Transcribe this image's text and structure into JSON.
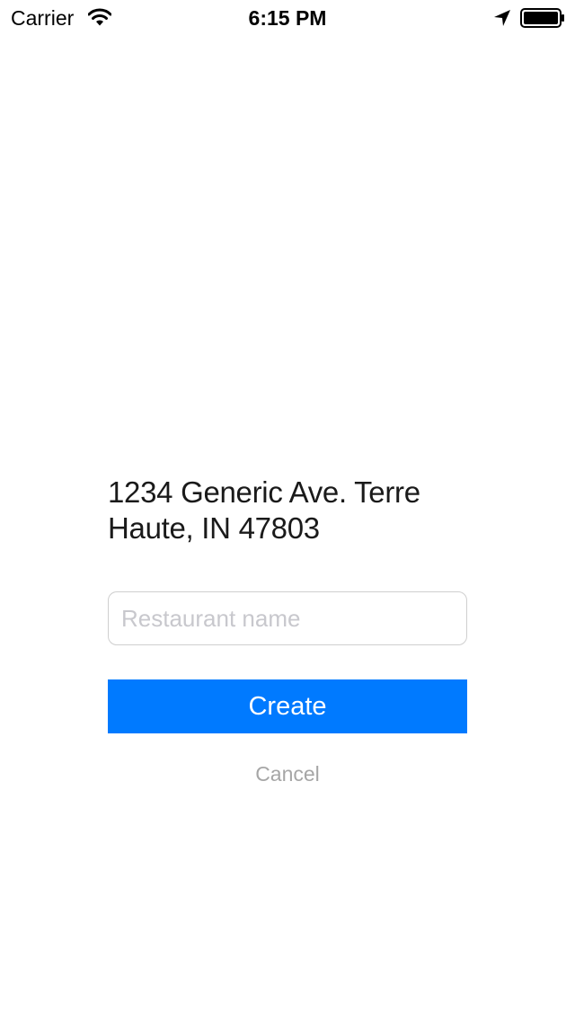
{
  "status_bar": {
    "carrier": "Carrier",
    "time": "6:15 PM",
    "icons": [
      "wifi-icon",
      "location-arrow-icon",
      "battery-icon"
    ]
  },
  "form": {
    "address": "1234 Generic Ave. Terre Haute, IN 47803",
    "name_input": {
      "value": "",
      "placeholder": "Restaurant name"
    },
    "create_label": "Create",
    "cancel_label": "Cancel"
  },
  "colors": {
    "accent": "#007aff",
    "cancel_text": "#a6a6a6",
    "placeholder": "#c8c8cd",
    "input_border": "#cfcfcf",
    "background": "#ffffff"
  }
}
